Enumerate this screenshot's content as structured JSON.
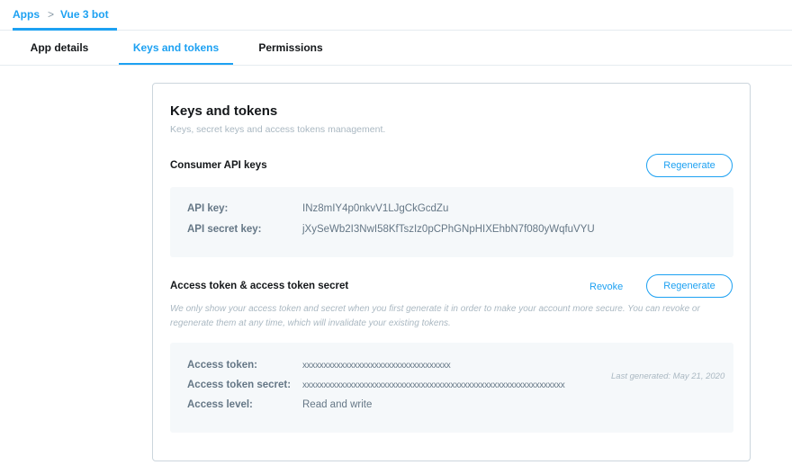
{
  "breadcrumb": {
    "apps": "Apps",
    "separator": ">",
    "current": "Vue 3 bot"
  },
  "tabs": [
    {
      "label": "App details"
    },
    {
      "label": "Keys and tokens"
    },
    {
      "label": "Permissions"
    }
  ],
  "card": {
    "title": "Keys and tokens",
    "subtitle": "Keys, secret keys and access tokens management.",
    "consumer": {
      "title": "Consumer API keys",
      "regenerate_label": "Regenerate",
      "rows": [
        {
          "key": "API key:",
          "value": "INz8mIY4p0nkvV1LJgCkGcdZu"
        },
        {
          "key": "API secret key:",
          "value": "jXySeWb2I3NwI58KfTszIz0pCPhGNpHIXEhbN7f080yWqfuVYU"
        }
      ]
    },
    "access": {
      "title": "Access token & access token secret",
      "revoke_label": "Revoke",
      "regenerate_label": "Regenerate",
      "note": "We only show your access token and secret when you first generate it in order to make your account more secure. You can revoke or regenerate them at any time, which will invalidate your existing tokens.",
      "last_generated": "Last generated: May 21, 2020",
      "rows": [
        {
          "key": "Access token:",
          "value": "xxxxxxxxxxxxxxxxxxxxxxxxxxxxxxxxxxx"
        },
        {
          "key": "Access token secret:",
          "value": "xxxxxxxxxxxxxxxxxxxxxxxxxxxxxxxxxxxxxxxxxxxxxxxxxxxxxxxxxxxxxx"
        },
        {
          "key": "Access level:",
          "value": "Read and write"
        }
      ]
    }
  },
  "colors": {
    "accent": "#1da1f2",
    "panel": "#f5f8fa",
    "muted": "#657786"
  }
}
